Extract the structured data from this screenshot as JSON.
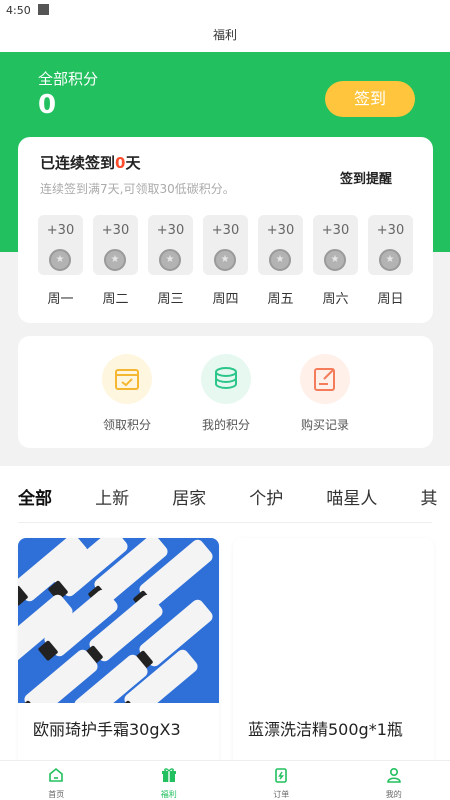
{
  "status": {
    "time": "4:50"
  },
  "header": {
    "title": "福利"
  },
  "points": {
    "label": "全部积分",
    "value": "0",
    "signin_button": "签到"
  },
  "checkin": {
    "streak_prefix": "已连续签到",
    "streak_days": "0",
    "streak_suffix": "天",
    "subtitle": "连续签到满7天,可领取30低碳积分。",
    "remind_label": "签到提醒",
    "days": [
      {
        "points": "+30",
        "name": "周一"
      },
      {
        "points": "+30",
        "name": "周二"
      },
      {
        "points": "+30",
        "name": "周三"
      },
      {
        "points": "+30",
        "name": "周四"
      },
      {
        "points": "+30",
        "name": "周五"
      },
      {
        "points": "+30",
        "name": "周六"
      },
      {
        "points": "+30",
        "name": "周日"
      }
    ]
  },
  "quick_actions": [
    {
      "label": "领取积分",
      "icon": "calendar-icon",
      "color": "#fff6e0"
    },
    {
      "label": "我的积分",
      "icon": "coins-icon",
      "color": "#e6f8f0"
    },
    {
      "label": "购买记录",
      "icon": "edit-record-icon",
      "color": "#fff0ea"
    }
  ],
  "tabs": [
    "全部",
    "上新",
    "居家",
    "个护",
    "喵星人",
    "其"
  ],
  "products": [
    {
      "title": "欧丽琦护手霜30gX3"
    },
    {
      "title": "蓝漂洗洁精500g*1瓶"
    }
  ],
  "bottom_nav": [
    {
      "label": "首页",
      "icon": "home-icon"
    },
    {
      "label": "福利",
      "icon": "gift-icon"
    },
    {
      "label": "订单",
      "icon": "order-icon"
    },
    {
      "label": "我的",
      "icon": "profile-icon"
    }
  ],
  "colors": {
    "brand": "#22c05e",
    "sign_button": "#ffc53d",
    "streak_highlight": "#ff4d2d"
  }
}
